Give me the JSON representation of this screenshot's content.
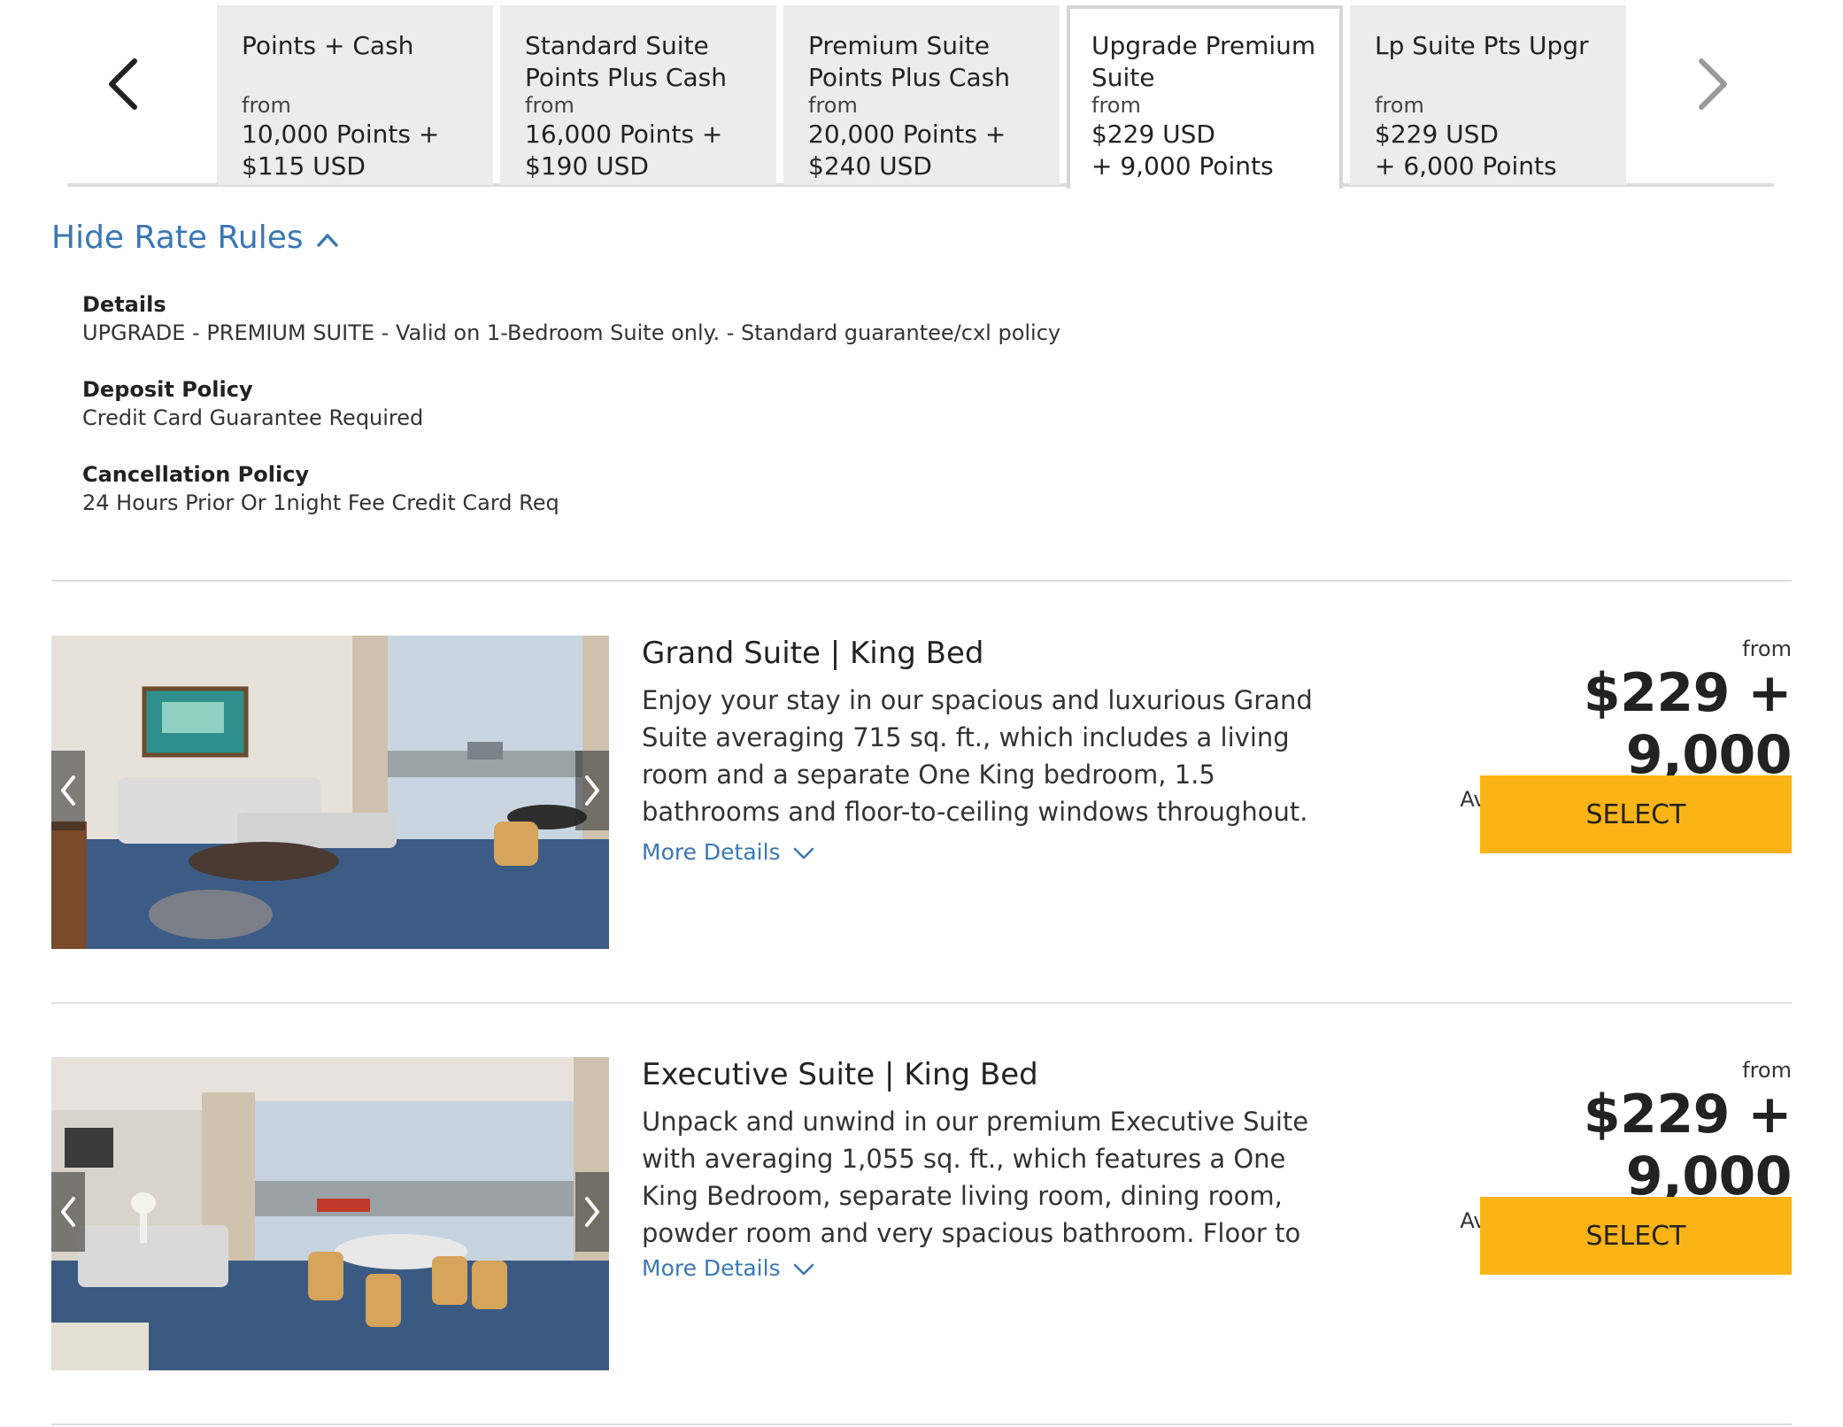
{
  "carousel": {
    "tabs": [
      {
        "name": "Points + Cash",
        "from": "from",
        "price_line1": "10,000 Points +",
        "price_line2": "$115 USD"
      },
      {
        "name": "Standard Suite Points Plus Cash",
        "from": "from",
        "price_line1": "16,000 Points +",
        "price_line2": "$190 USD"
      },
      {
        "name": "Premium Suite Points Plus Cash",
        "from": "from",
        "price_line1": "20,000 Points +",
        "price_line2": "$240 USD"
      },
      {
        "name": "Upgrade Premium Suite",
        "from": "from",
        "price_line1": "$229 USD",
        "price_line2": "+ 9,000 Points",
        "selected": true
      },
      {
        "name": "Lp Suite Pts Upgr",
        "from": "from",
        "price_line1": "$229 USD",
        "price_line2": "+ 6,000 Points"
      }
    ],
    "prev_icon": "chevron-left-icon",
    "next_icon": "chevron-right-icon"
  },
  "rules": {
    "toggle_label": "Hide Rate Rules",
    "toggle_icon": "chevron-up-icon",
    "items": [
      {
        "label": "Details",
        "value": "UPGRADE - PREMIUM SUITE - Valid on 1-Bedroom Suite only. - Standard guarantee/cxl policy"
      },
      {
        "label": "Deposit Policy",
        "value": "Credit Card Guarantee Required"
      },
      {
        "label": "Cancellation Policy",
        "value": "24 Hours Prior Or 1night Fee Credit Card Req"
      }
    ]
  },
  "rooms": [
    {
      "title": "Grand Suite | King Bed",
      "description": "Enjoy your stay in our spacious and luxurious Grand Suite averaging 715 sq. ft., which includes a living room and a separate One King bedroom, 1.5 bathrooms and floor-to-ceiling windows throughout.",
      "more_label": "More Details",
      "from_label": "from",
      "price": "$229 + 9,000",
      "price_unit": "Avg/Night (USD) + Points/Night",
      "select_label": "SELECT"
    },
    {
      "title": "Executive Suite | King Bed",
      "description": "Unpack and unwind in our premium Executive Suite with averaging 1,055 sq. ft., which features a One King Bedroom, separate living room, dining room, powder room and very spacious bathroom. Floor to ceiling windows allowing expansive views of SFO and the Bay.",
      "more_label": "More Details",
      "from_label": "from",
      "price": "$229 + 9,000",
      "price_unit": "Avg/Night (USD) + Points/Night",
      "select_label": "SELECT"
    }
  ],
  "colors": {
    "link": "#3a77b5",
    "select_button": "#fbb415",
    "tab_inactive": "#ececec"
  }
}
